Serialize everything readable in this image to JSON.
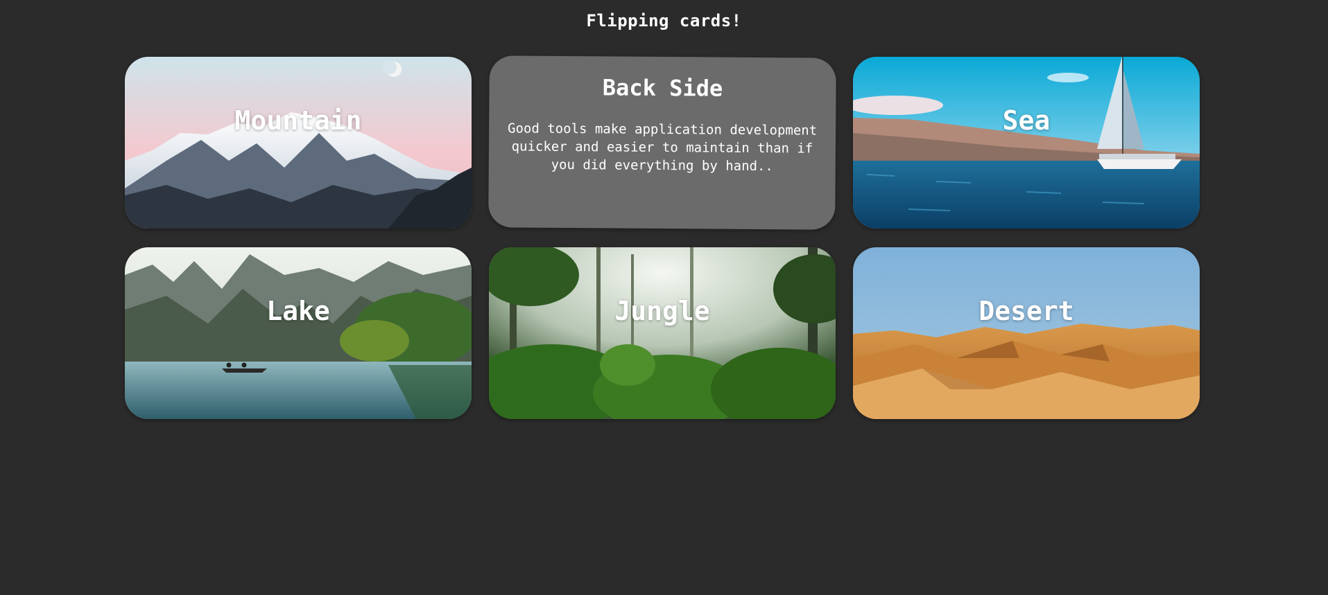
{
  "page": {
    "title": "Flipping cards!",
    "background": "#2b2b2b"
  },
  "cards": [
    {
      "name": "card-mountain",
      "title": "Mountain",
      "side": "front",
      "icon": "mountain-scene"
    },
    {
      "name": "card-back",
      "side": "back",
      "back_title": "Back Side",
      "back_text": "Good tools make application development quicker and easier to maintain than if you did everything by hand..",
      "color": "#6b6b6b"
    },
    {
      "name": "card-sea",
      "title": "Sea",
      "side": "front",
      "icon": "sailboat-scene"
    },
    {
      "name": "card-lake",
      "title": "Lake",
      "side": "front",
      "icon": "lake-scene"
    },
    {
      "name": "card-jungle",
      "title": "Jungle",
      "side": "front",
      "icon": "jungle-scene"
    },
    {
      "name": "card-desert",
      "title": "Desert",
      "side": "front",
      "icon": "desert-scene"
    }
  ]
}
